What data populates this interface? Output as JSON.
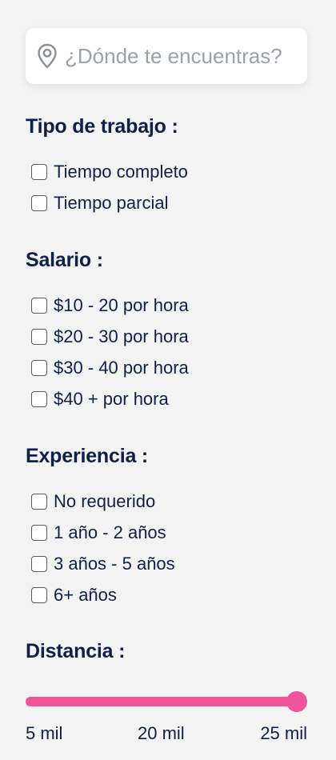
{
  "search": {
    "placeholder": "¿Dónde te encuentras?",
    "icon": "location-pin-icon"
  },
  "job_type": {
    "title": "Tipo de trabajo :",
    "options": [
      {
        "label": "Tiempo completo",
        "checked": false
      },
      {
        "label": "Tiempo parcial",
        "checked": false
      }
    ]
  },
  "salary": {
    "title": "Salario :",
    "options": [
      {
        "label": "$10 - 20 por hora",
        "checked": false
      },
      {
        "label": "$20 - 30 por hora",
        "checked": false
      },
      {
        "label": "$30 - 40 por hora",
        "checked": false
      },
      {
        "label": "$40 + por hora",
        "checked": false
      }
    ]
  },
  "experience": {
    "title": "Experiencia :",
    "options": [
      {
        "label": "No requerido",
        "checked": false
      },
      {
        "label": "1 año - 2 años",
        "checked": false
      },
      {
        "label": "3 años - 5 años",
        "checked": false
      },
      {
        "label": "6+ años",
        "checked": false
      }
    ]
  },
  "distance": {
    "title": "Distancia :",
    "slider_value_fraction": 1.0,
    "min_label": "5 mil",
    "mid_label": "20 mil",
    "max_label": "25 mil",
    "accent_color": "#f0539a"
  },
  "colors": {
    "text": "#0f1f47",
    "background": "#f3f3f4"
  }
}
